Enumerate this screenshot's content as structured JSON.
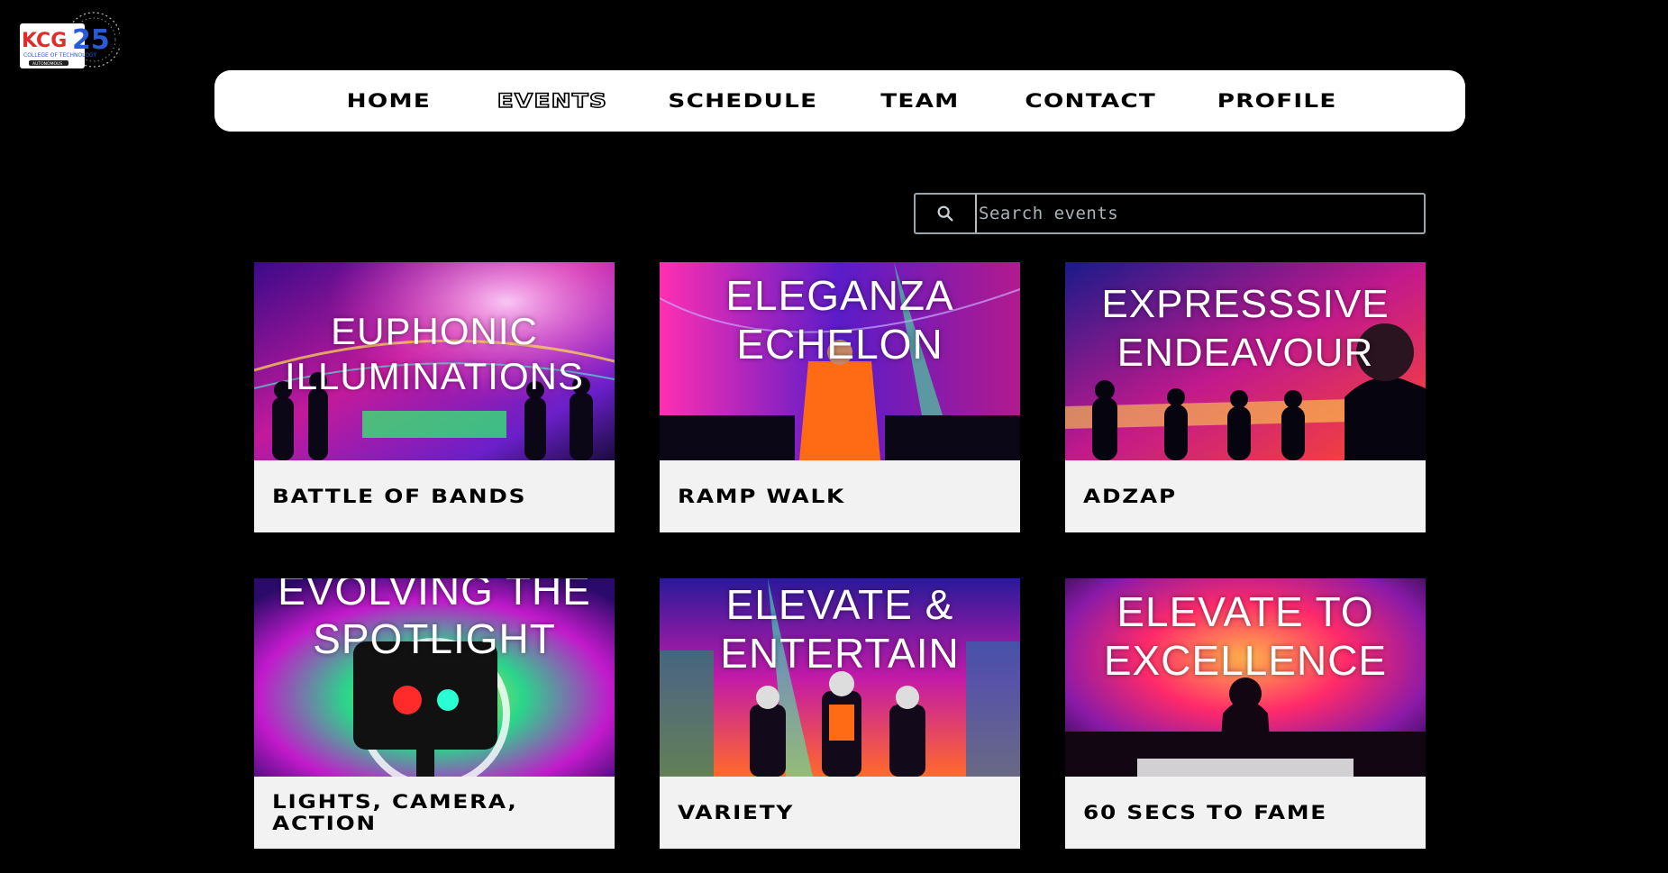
{
  "logo": {
    "text": "KCG",
    "number": "25",
    "subtitle": "COLLEGE OF TECHNOLOGY",
    "tag": "AUTONOMOUS"
  },
  "nav": {
    "items": [
      {
        "label": "HOME"
      },
      {
        "label": "EVENTS"
      },
      {
        "label": "SCHEDULE"
      },
      {
        "label": "TEAM"
      },
      {
        "label": "CONTACT"
      },
      {
        "label": "PROFILE"
      }
    ]
  },
  "search": {
    "placeholder": "Search events",
    "value": ""
  },
  "events": [
    {
      "image_title": "EUPHONIC\nILLUMINATIONS",
      "label": "BATTLE OF BANDS"
    },
    {
      "image_title": "ELEGANZA\nECHELON",
      "label": "RAMP WALK"
    },
    {
      "image_title": "EXPRESSSIVE\nENDEAVOUR",
      "label": "ADZAP"
    },
    {
      "image_title": "EVOLVING THE\nSPOTLIGHT",
      "label": "LIGHTS, CAMERA, ACTION"
    },
    {
      "image_title": "ELEVATE &\nENTERTAIN",
      "label": "VARIETY"
    },
    {
      "image_title": "ELEVATE TO\nEXCELLENCE",
      "label": "60 SECS TO FAME"
    }
  ],
  "colors": {
    "background": "#000000",
    "nav_background": "#ffffff",
    "card_label_background": "#f2f2f2",
    "search_border": "#9aa6ad"
  }
}
